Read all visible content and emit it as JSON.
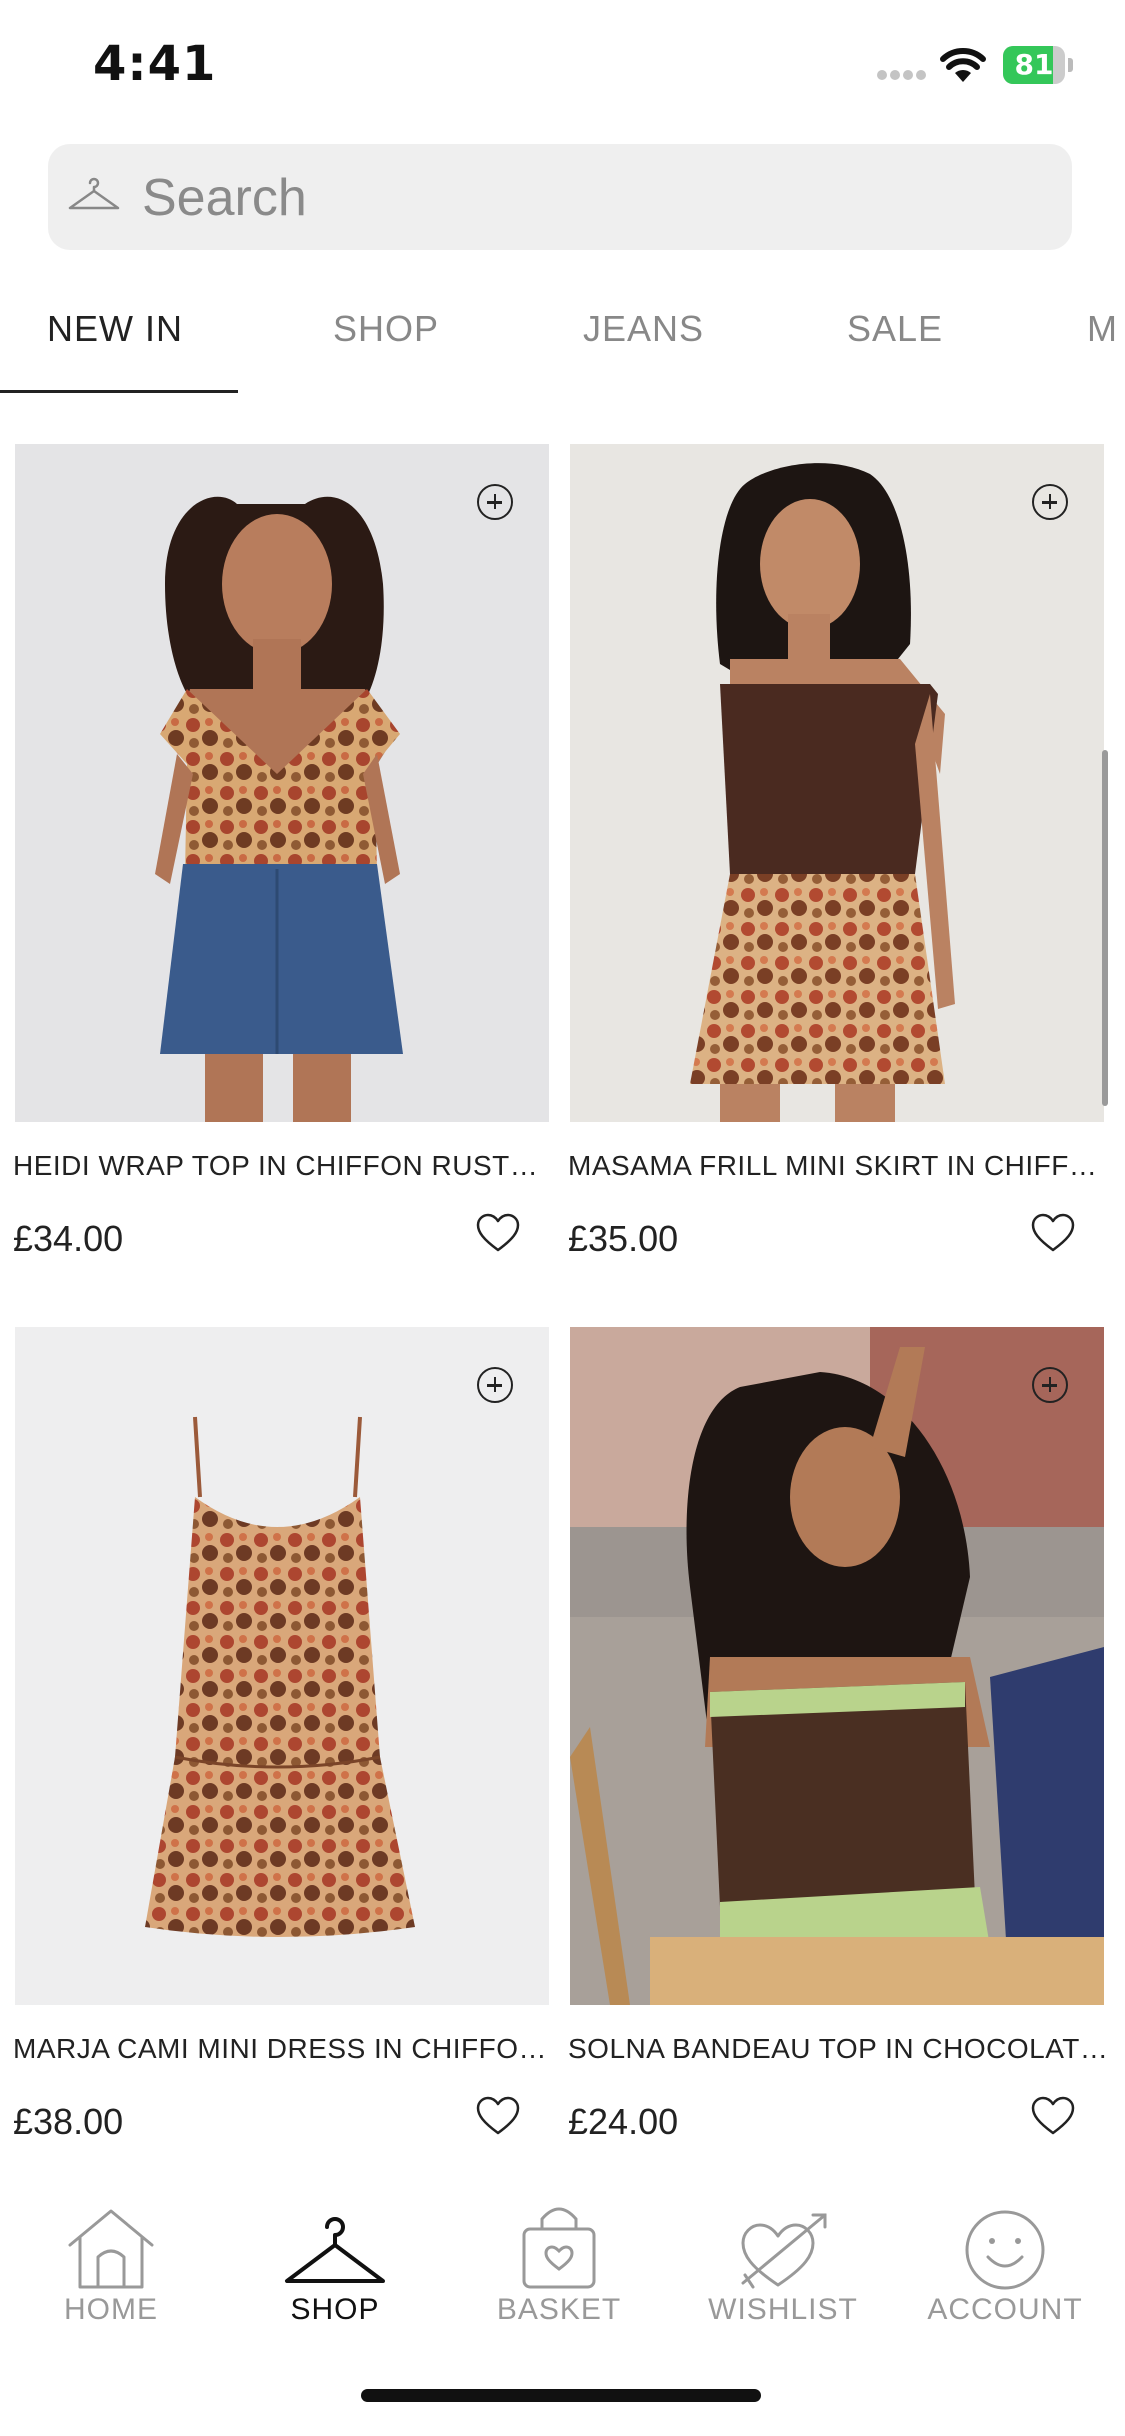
{
  "status_bar": {
    "time": "4:41",
    "battery_percent": "81",
    "battery_level": 0.81,
    "battery_color": "#34c759",
    "icons": [
      "signal-icon",
      "wifi-icon",
      "battery-charging-icon"
    ]
  },
  "search": {
    "placeholder": "Search",
    "icon": "hanger-icon"
  },
  "tabs": [
    {
      "label": "NEW IN",
      "active": true
    },
    {
      "label": "SHOP",
      "active": false
    },
    {
      "label": "JEANS",
      "active": false
    },
    {
      "label": "SALE",
      "active": false
    },
    {
      "label": "M",
      "active": false
    }
  ],
  "products": [
    {
      "name": "HEIDI WRAP TOP IN CHIFFON RUSTY…",
      "price": "£34.00"
    },
    {
      "name": "MASAMA FRILL MINI SKIRT IN CHIFFO…",
      "price": "£35.00"
    },
    {
      "name": "MARJA CAMI MINI DRESS IN CHIFFON…",
      "price": "£38.00"
    },
    {
      "name": "SOLNA BANDEAU TOP IN CHOCOLAT…",
      "price": "£24.00"
    }
  ],
  "bottom_nav": {
    "active": "SHOP",
    "items": [
      {
        "label": "HOME",
        "icon": "home-icon"
      },
      {
        "label": "SHOP",
        "icon": "hanger-icon"
      },
      {
        "label": "BASKET",
        "icon": "basket-icon"
      },
      {
        "label": "WISHLIST",
        "icon": "heart-arrow-icon"
      },
      {
        "label": "ACCOUNT",
        "icon": "smiley-icon"
      }
    ]
  }
}
